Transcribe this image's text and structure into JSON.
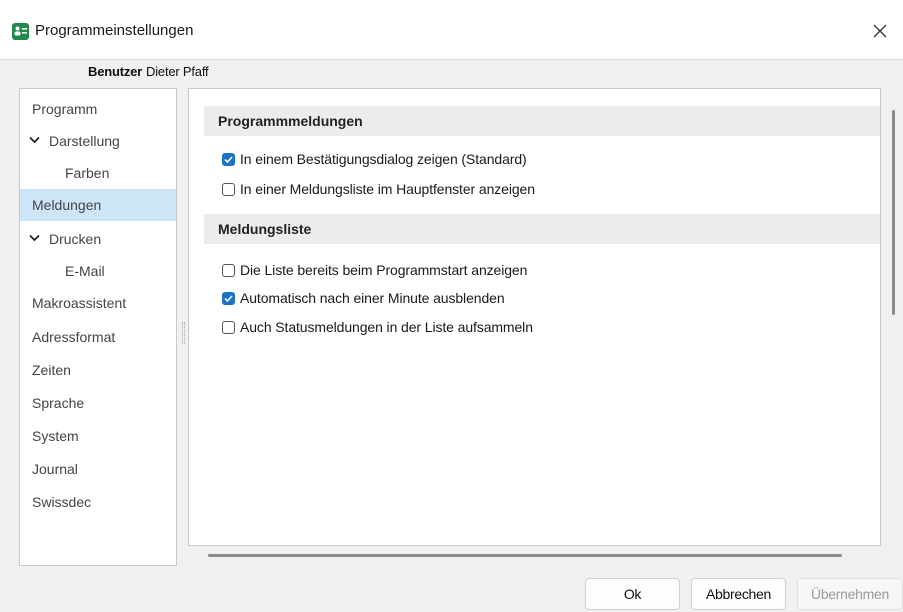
{
  "window": {
    "title": "Programmeinstellungen",
    "accent_color": "#1a73c7",
    "icon_color": "#1f8a4c"
  },
  "user": {
    "label": "Benutzer",
    "name": "Dieter Pfaff"
  },
  "sidebar": {
    "items": [
      {
        "label": "Programm",
        "selected": false,
        "expandable": false,
        "indent": 0
      },
      {
        "label": "Darstellung",
        "selected": false,
        "expandable": true,
        "indent": 0
      },
      {
        "label": "Farben",
        "selected": false,
        "expandable": false,
        "indent": 1
      },
      {
        "label": "Meldungen",
        "selected": true,
        "expandable": false,
        "indent": 0
      },
      {
        "label": "Drucken",
        "selected": false,
        "expandable": true,
        "indent": 0
      },
      {
        "label": "E-Mail",
        "selected": false,
        "expandable": false,
        "indent": 1
      },
      {
        "label": "Makroassistent",
        "selected": false,
        "expandable": false,
        "indent": 0
      },
      {
        "label": "Adressformat",
        "selected": false,
        "expandable": false,
        "indent": 0
      },
      {
        "label": "Zeiten",
        "selected": false,
        "expandable": false,
        "indent": 0
      },
      {
        "label": "Sprache",
        "selected": false,
        "expandable": false,
        "indent": 0
      },
      {
        "label": "System",
        "selected": false,
        "expandable": false,
        "indent": 0
      },
      {
        "label": "Journal",
        "selected": false,
        "expandable": false,
        "indent": 0
      },
      {
        "label": "Swissdec",
        "selected": false,
        "expandable": false,
        "indent": 0
      }
    ]
  },
  "content": {
    "sections": [
      {
        "title": "Programmmeldungen",
        "options": [
          {
            "label": "In einem Bestätigungsdialog zeigen (Standard)",
            "checked": true
          },
          {
            "label": "In einer Meldungsliste im Hauptfenster anzeigen",
            "checked": false
          }
        ]
      },
      {
        "title": "Meldungsliste",
        "options": [
          {
            "label": "Die Liste bereits beim Programmstart anzeigen",
            "checked": false
          },
          {
            "label": "Automatisch nach einer Minute ausblenden",
            "checked": true
          },
          {
            "label": "Auch Statusmeldungen in der Liste aufsammeln",
            "checked": false
          }
        ]
      }
    ]
  },
  "buttons": {
    "ok": "Ok",
    "cancel": "Abbrechen",
    "apply": "Übernehmen"
  }
}
